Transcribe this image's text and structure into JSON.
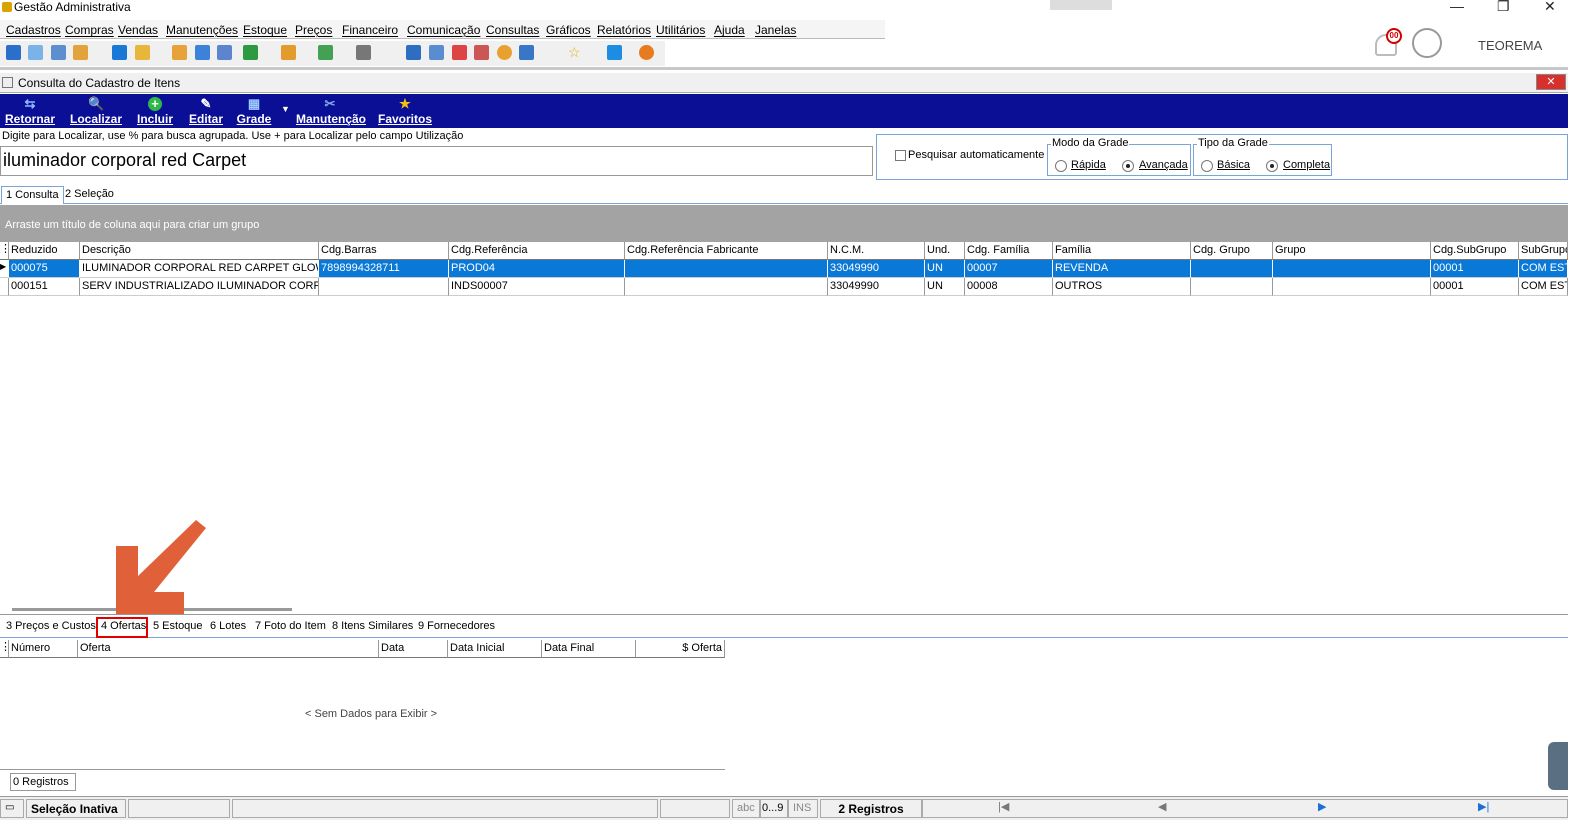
{
  "app": {
    "title": "Gestão Administrativa"
  },
  "menu": [
    "Cadastros",
    "Compras",
    "Vendas",
    "Manutenções",
    "Estoque",
    "Preços",
    "Financeiro",
    "Comunicação",
    "Consultas",
    "Gráficos",
    "Relatórios",
    "Utilitários",
    "Ajuda",
    "Janelas"
  ],
  "user": {
    "name": "TEOREMA",
    "notif_count": "00"
  },
  "form": {
    "title": "Consulta do Cadastro de Itens",
    "close": "✕"
  },
  "actions": [
    {
      "label": "Retornar",
      "icon": "return-icon"
    },
    {
      "label": "Localizar",
      "icon": "search-icon"
    },
    {
      "label": "Incluir",
      "icon": "plus-icon"
    },
    {
      "label": "Editar",
      "icon": "edit-icon"
    },
    {
      "label": "Grade",
      "icon": "grid-icon"
    },
    {
      "label": "Manutenção",
      "icon": "tools-icon"
    },
    {
      "label": "Favoritos",
      "icon": "star-icon"
    }
  ],
  "search": {
    "hint": "Digite para Localizar, use % para busca agrupada. Use + para Localizar pelo campo Utilização",
    "value": "iluminador corporal red Carpet",
    "auto_label": "Pesquisar automaticamente"
  },
  "modo_grade": {
    "caption": "Modo da Grade",
    "opt1": "Rápida",
    "opt2": "Avançada",
    "selected": "Avançada"
  },
  "tipo_grade": {
    "caption": "Tipo da Grade",
    "opt1": "Básica",
    "opt2": "Completa",
    "selected": "Completa"
  },
  "tabs_top": [
    "1 Consulta",
    "2 Seleção"
  ],
  "group_hint": "Arraste um título de coluna aqui para criar um grupo",
  "grid": {
    "columns": [
      "Reduzido",
      "Descrição",
      "Cdg.Barras",
      "Cdg.Referência",
      "Cdg.Referência Fabricante",
      "N.C.M.",
      "Und.",
      "Cdg. Família",
      "Família",
      "Cdg. Grupo",
      "Grupo",
      "Cdg.SubGrupo",
      "SubGrupo"
    ],
    "rows": [
      [
        "000075",
        "ILUMINADOR CORPORAL RED CARPET GLOW",
        "7898994328711",
        "PROD04",
        "",
        "33049990",
        "UN",
        "00007",
        "REVENDA",
        "",
        "",
        "00001",
        "COM EST"
      ],
      [
        "000151",
        "SERV INDUSTRIALIZADO ILUMINADOR CORPORAL",
        "",
        "INDS00007",
        "",
        "33049990",
        "UN",
        "00008",
        "OUTROS",
        "",
        "",
        "00001",
        "COM EST"
      ]
    ]
  },
  "tabs_bottom": [
    "3 Preços e Custos",
    "4 Ofertas",
    "5 Estoque",
    "6 Lotes",
    "7 Foto do Item",
    "8 Itens Similares",
    "9 Fornecedores"
  ],
  "ofertas": {
    "columns": [
      "Número",
      "Oferta",
      "Data",
      "Data Inicial",
      "Data Final",
      "$ Oferta"
    ],
    "empty": "< Sem Dados para Exibir >",
    "count": "0 Registros"
  },
  "status": {
    "selecao": "Seleção Inativa",
    "abc": "abc",
    "num": "0...9",
    "ins": "INS",
    "registros": "2 Registros"
  },
  "colors": {
    "accent_bar": "#0b0f96",
    "selection": "#0a78d7",
    "highlight": "#e00000",
    "arrow": "#e0603a"
  }
}
